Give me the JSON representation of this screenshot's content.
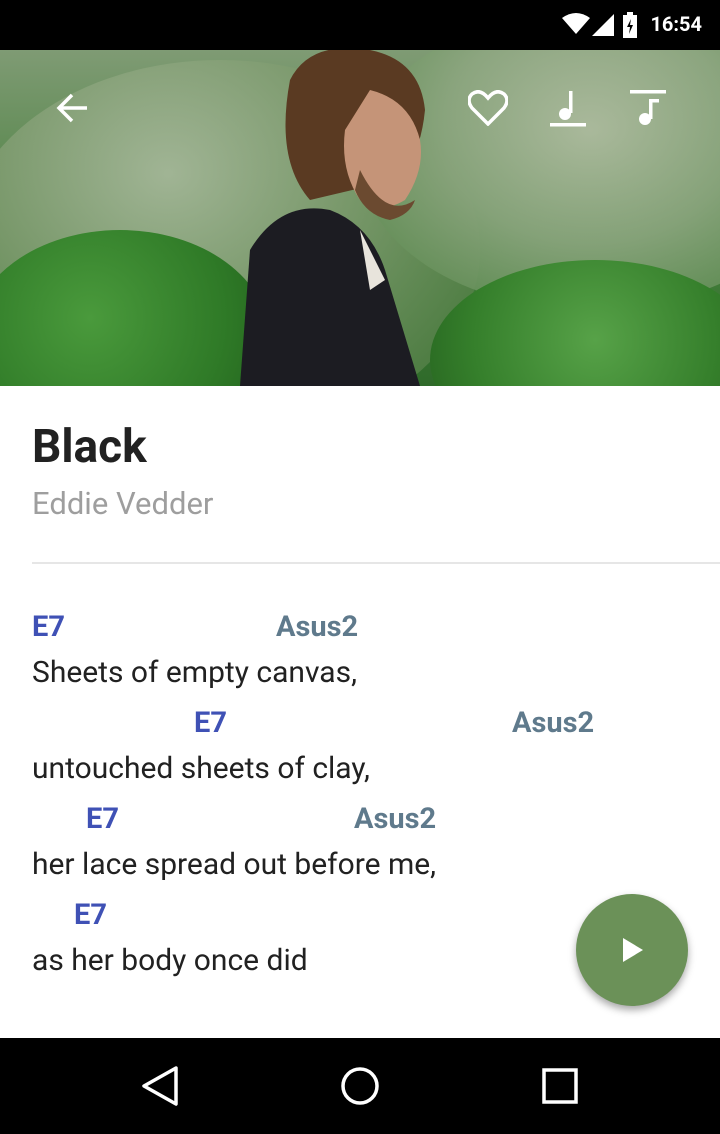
{
  "status_bar": {
    "time": "16:54",
    "icons": [
      "wifi-icon",
      "cell-signal-icon",
      "battery-icon"
    ]
  },
  "toolbar": {
    "back_icon": "arrow-back-icon",
    "actions": [
      "favorite-heart-icon",
      "music-note-icon",
      "music-note-alt-icon"
    ]
  },
  "song": {
    "title": "Black",
    "artist": "Eddie Vedder"
  },
  "lyrics": [
    {
      "chords": [
        "E7",
        "Asus2"
      ],
      "text": "Sheets of empty canvas,"
    },
    {
      "chords": [
        "E7",
        "Asus2"
      ],
      "text": "untouched sheets of clay,"
    },
    {
      "chords": [
        "E7",
        "Asus2"
      ],
      "text": "her lace spread out before me,"
    },
    {
      "chords": [
        "E7"
      ],
      "text": "as her body once did"
    }
  ],
  "fab": {
    "icon": "play-icon"
  },
  "nav_bar": {
    "icons": [
      "back-triangle-icon",
      "home-circle-icon",
      "recents-square-icon"
    ]
  },
  "colors": {
    "chord_primary": "#3f51b5",
    "chord_secondary": "#5f7a8c",
    "fab": "#6b9158",
    "title": "#212121",
    "artist": "#9e9e9e"
  }
}
